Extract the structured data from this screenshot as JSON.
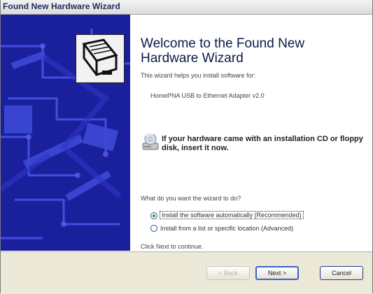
{
  "window": {
    "title": "Found New Hardware Wizard"
  },
  "wizard": {
    "heading": "Welcome to the Found New Hardware Wizard",
    "intro": "This wizard helps you install software for:",
    "device": "HomePNA USB to Ethernet Adapter v2.0",
    "cd_prompt": "If your hardware came with an installation CD or floppy disk, insert it now.",
    "question": "What do you want the wizard to do?",
    "options": [
      {
        "label": "Install the software automatically (Recommended)",
        "selected": true
      },
      {
        "label": "Install from a list or specific location (Advanced)",
        "selected": false
      }
    ],
    "continue_hint": "Click Next to continue."
  },
  "buttons": {
    "back": "< Back",
    "next": "Next >",
    "cancel": "Cancel"
  },
  "icons": {
    "wizard": "hardware-card-icon",
    "cd": "cd-drive-icon"
  },
  "colors": {
    "side_panel": "#1a1f9c",
    "footer": "#ece9d8",
    "title_text": "#1d2b5a"
  }
}
